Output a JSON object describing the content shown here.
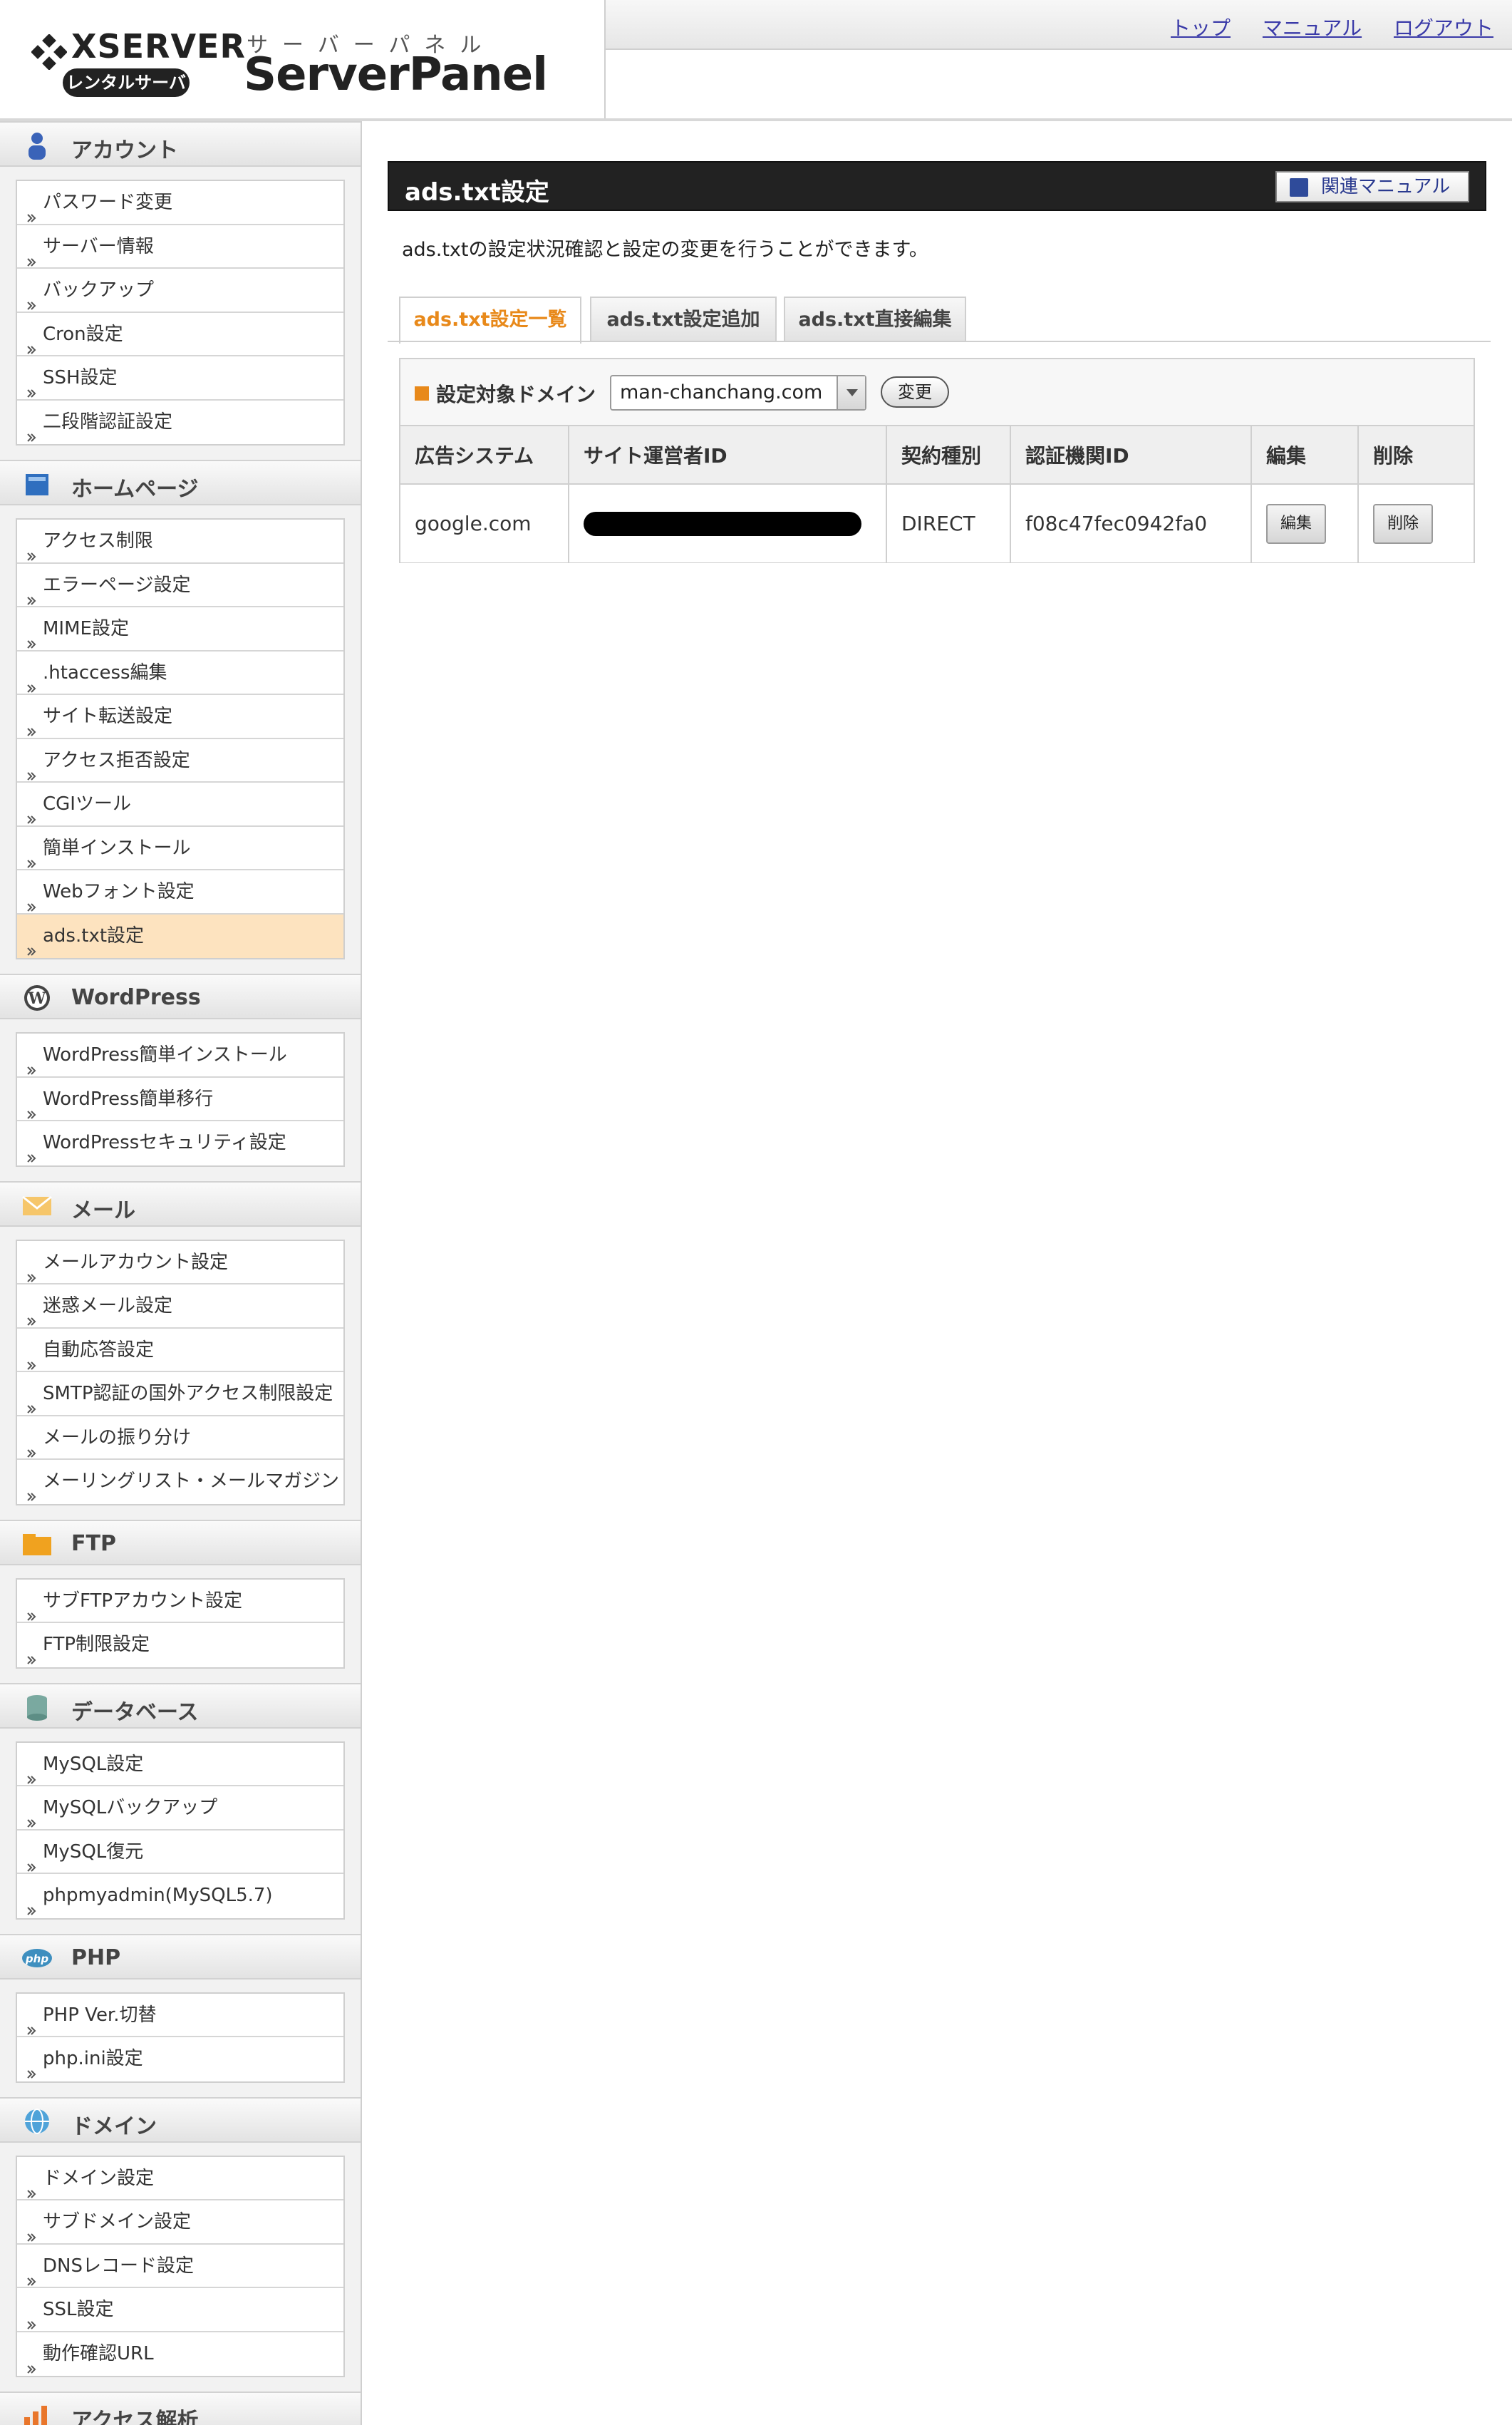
{
  "header": {
    "brand": "XSERVER",
    "badge": "レンタルサーバー",
    "panel_kana": "サーバーパネル",
    "panel_title": "ServerPanel",
    "links": [
      "トップ",
      "マニュアル",
      "ログアウト"
    ]
  },
  "sidebar": {
    "sections": [
      {
        "title": "アカウント",
        "icon": "user-icon",
        "items": [
          "パスワード変更",
          "サーバー情報",
          "バックアップ",
          "Cron設定",
          "SSH設定",
          "二段階認証設定"
        ]
      },
      {
        "title": "ホームページ",
        "icon": "homepage-icon",
        "items": [
          "アクセス制限",
          "エラーページ設定",
          "MIME設定",
          ".htaccess編集",
          "サイト転送設定",
          "アクセス拒否設定",
          "CGIツール",
          "簡単インストール",
          "Webフォント設定",
          "ads.txt設定"
        ]
      },
      {
        "title": "WordPress",
        "icon": "wordpress-icon",
        "items": [
          "WordPress簡単インストール",
          "WordPress簡単移行",
          "WordPressセキュリティ設定"
        ]
      },
      {
        "title": "メール",
        "icon": "mail-icon",
        "items": [
          "メールアカウント設定",
          "迷惑メール設定",
          "自動応答設定",
          "SMTP認証の国外アクセス制限設定",
          "メールの振り分け",
          "メーリングリスト・メールマガジン"
        ]
      },
      {
        "title": "FTP",
        "icon": "folder-icon",
        "items": [
          "サブFTPアカウント設定",
          "FTP制限設定"
        ]
      },
      {
        "title": "データベース",
        "icon": "database-icon",
        "items": [
          "MySQL設定",
          "MySQLバックアップ",
          "MySQL復元",
          "phpmyadmin(MySQL5.7)"
        ]
      },
      {
        "title": "PHP",
        "icon": "php-icon",
        "items": [
          "PHP Ver.切替",
          "php.ini設定"
        ]
      },
      {
        "title": "ドメイン",
        "icon": "globe-icon",
        "items": [
          "ドメイン設定",
          "サブドメイン設定",
          "DNSレコード設定",
          "SSL設定",
          "動作確認URL"
        ]
      },
      {
        "title": "アクセス解析",
        "icon": "chart-icon",
        "items": []
      }
    ],
    "active_item": "ads.txt設定"
  },
  "main": {
    "title": "ads.txt設定",
    "manual_button": "関連マニュアル",
    "description": "ads.txtの設定状況確認と設定の変更を行うことができます。",
    "tabs": [
      "ads.txt設定一覧",
      "ads.txt設定追加",
      "ads.txt直接編集"
    ],
    "active_tab": "ads.txt設定一覧",
    "domain_label": "設定対象ドメイン",
    "domain_value": "man-chanchang.com",
    "change_button": "変更",
    "table": {
      "headers": [
        "広告システム",
        "サイト運営者ID",
        "契約種別",
        "認証機関ID",
        "編集",
        "削除"
      ],
      "rows": [
        {
          "system": "google.com",
          "publisher_id": "",
          "type": "DIRECT",
          "cert_id": "f08c47fec0942fa0",
          "edit": "編集",
          "delete": "削除"
        }
      ]
    }
  },
  "colors": {
    "accent_orange": "#e8891a",
    "title_bar": "#222222",
    "link_blue": "#3a3aa8",
    "active_item_bg": "#fde3bf"
  }
}
